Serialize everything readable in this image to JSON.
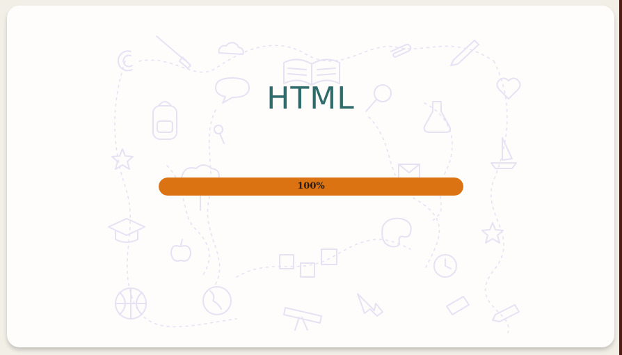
{
  "title": "HTML",
  "progress": {
    "label": "100%",
    "value": 1.0,
    "color": "#dc7312"
  },
  "theme": {
    "card_background": "#fffdfc",
    "page_background": "#f1efe6",
    "title_color": "#2f6b6b"
  },
  "background_doodles": [
    "magnet-icon",
    "paintbrush-icon",
    "cloud-icon",
    "open-book-icon",
    "paperclip-icon",
    "pencil-icon",
    "speech-bubble-icon",
    "magnifier-icon",
    "heart-icon",
    "backpack-icon",
    "pushpin-icon",
    "flask-icon",
    "sailboat-icon",
    "star-icon",
    "envelope-icon",
    "tree-icon",
    "graduation-cap-icon",
    "palette-icon",
    "apple-icon",
    "alphabet-blocks-icon",
    "clock-icon",
    "basketball-icon",
    "globe-icon",
    "telescope-icon",
    "arrow-icon",
    "eraser-icon",
    "crayon-icon"
  ]
}
